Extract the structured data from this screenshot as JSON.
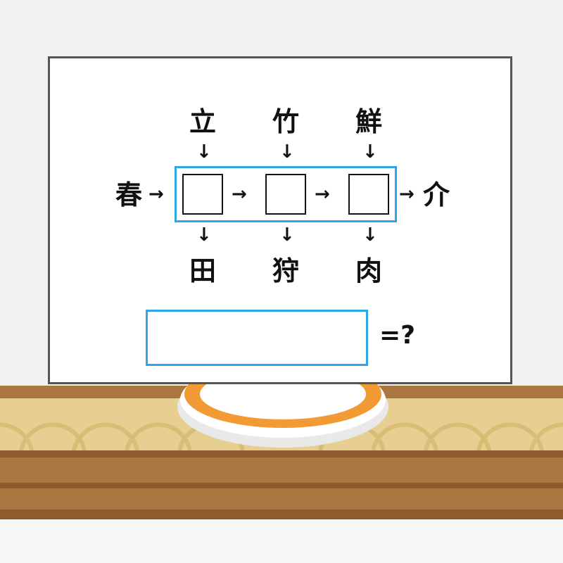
{
  "puzzle": {
    "left": "春",
    "right": "介",
    "top": [
      "立",
      "竹",
      "鮮"
    ],
    "bottom": [
      "田",
      "狩",
      "肉"
    ],
    "answer_suffix": "=?"
  },
  "colors": {
    "board_border": "#555555",
    "highlight_border": "#2fa6e8",
    "plate_rim": "#f29a33",
    "counter_wood": "#e7cf91",
    "counter_dark": "#9c6a36"
  }
}
